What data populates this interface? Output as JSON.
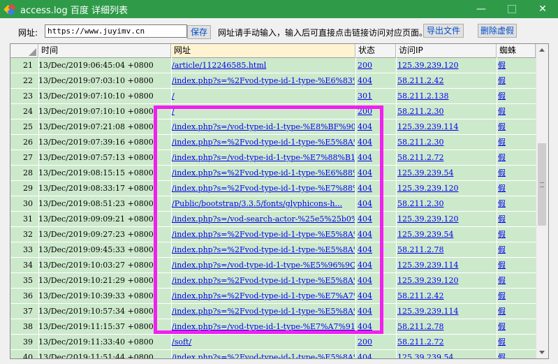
{
  "window": {
    "title": "access.log 百度 详细列表",
    "minimize": "—",
    "close": "✕"
  },
  "toolbar": {
    "url_label": "网址:",
    "url_value": "https://www.juyimv.cn",
    "save_label": "保存",
    "hint": "网址请手动输入，输入后可直接点击链接访问对应页面。",
    "export_label": "导出文件",
    "delete_label": "删除虚假"
  },
  "table": {
    "columns": [
      "时间",
      "网址",
      "状态",
      "访问IP",
      "蜘蛛"
    ],
    "rows": [
      {
        "num": "21",
        "time": "13/Dec/2019:06:45:04 +0800",
        "url": "/article/112246585.html",
        "status": "200",
        "ip": "125.39.239.120",
        "spider": "假"
      },
      {
        "num": "22",
        "time": "13/Dec/2019:07:03:10 +0800",
        "url": "/index.php?s=%2Fvod-type-id-1-type-%E6%83%...",
        "status": "404",
        "ip": "58.211.2.42",
        "spider": "假"
      },
      {
        "num": "23",
        "time": "13/Dec/2019:07:10:10 +0800",
        "url": "/",
        "status": "301",
        "ip": "58.211.2.138",
        "spider": "假"
      },
      {
        "num": "24",
        "time": "13/Dec/2019:07:10:10 +0800",
        "url": "/",
        "status": "200",
        "ip": "58.211.2.30",
        "spider": "假"
      },
      {
        "num": "25",
        "time": "13/Dec/2019:07:21:08 +0800",
        "url": "/index.php?s=/vod-type-id-1-type-%E8%BF%90...",
        "status": "404",
        "ip": "125.39.239.114",
        "spider": "假"
      },
      {
        "num": "26",
        "time": "13/Dec/2019:07:39:16 +0800",
        "url": "/index.php?s=%2Fvod-type-id-1-type-%E5%8A%...",
        "status": "404",
        "ip": "58.211.2.30",
        "spider": "假"
      },
      {
        "num": "27",
        "time": "13/Dec/2019:07:57:13 +0800",
        "url": "/index.php?s=/vod-type-id-1-type-%E7%88%B1...",
        "status": "404",
        "ip": "58.211.2.72",
        "spider": "假"
      },
      {
        "num": "28",
        "time": "13/Dec/2019:08:15:15 +0800",
        "url": "/index.php?s=%2Fvod-type-id-1-type-%E6%88%...",
        "status": "404",
        "ip": "125.39.239.54",
        "spider": "假"
      },
      {
        "num": "29",
        "time": "13/Dec/2019:08:33:17 +0800",
        "url": "/index.php?s=%2Fvod-type-id-1-type-%E7%88%...",
        "status": "404",
        "ip": "125.39.239.120",
        "spider": "假"
      },
      {
        "num": "30",
        "time": "13/Dec/2019:08:51:23 +0800",
        "url": "/Public/bootstrap/3.3.5/fonts/glyphicons-h...",
        "status": "404",
        "ip": "58.211.2.30",
        "spider": "假"
      },
      {
        "num": "31",
        "time": "13/Dec/2019:09:09:21 +0800",
        "url": "/index.php?s=/vod-search-actor-%25e5%25b0%...",
        "status": "404",
        "ip": "125.39.239.120",
        "spider": "假"
      },
      {
        "num": "32",
        "time": "13/Dec/2019:09:27:23 +0800",
        "url": "/index.php?s=%2Fvod-type-id-1-type-%E5%8A%...",
        "status": "404",
        "ip": "125.39.239.54",
        "spider": "假"
      },
      {
        "num": "33",
        "time": "13/Dec/2019:09:45:33 +0800",
        "url": "/index.php?s=%2Fvod-type-id-1-type-%E5%8A%...",
        "status": "404",
        "ip": "58.211.2.78",
        "spider": "假"
      },
      {
        "num": "34",
        "time": "13/Dec/2019:10:03:27 +0800",
        "url": "/index.php?s=/vod-type-id-1-type-%E5%96%9C...",
        "status": "404",
        "ip": "125.39.239.114",
        "spider": "假"
      },
      {
        "num": "35",
        "time": "13/Dec/2019:10:21:29 +0800",
        "url": "/index.php?s=%2Fvod-type-id-1-type-%E5%8A%...",
        "status": "404",
        "ip": "125.39.239.120",
        "spider": "假"
      },
      {
        "num": "36",
        "time": "13/Dec/2019:10:39:33 +0800",
        "url": "/index.php?s=%2Fvod-type-id-1-type-%E7%A7%...",
        "status": "404",
        "ip": "58.211.2.42",
        "spider": "假"
      },
      {
        "num": "37",
        "time": "13/Dec/2019:10:57:34 +0800",
        "url": "/index.php?s=%2Fvod-type-id-1-type-%E5%8A%...",
        "status": "404",
        "ip": "125.39.239.114",
        "spider": "假"
      },
      {
        "num": "38",
        "time": "13/Dec/2019:11:15:37 +0800",
        "url": "/index.php?s=/vod-type-id-1-type-%E7%A7%91...",
        "status": "404",
        "ip": "58.211.2.78",
        "spider": "假"
      },
      {
        "num": "39",
        "time": "13/Dec/2019:11:33:40 +0800",
        "url": "/soft/",
        "status": "200",
        "ip": "58.211.2.72",
        "spider": "假"
      },
      {
        "num": "40",
        "time": "13/Dec/2019:11:51:44 +0800",
        "url": "/index.php?s=%2Fvod-type-id-1-type-%E5%8A%...",
        "status": "404",
        "ip": "125.39.239.54",
        "spider": "假"
      }
    ]
  },
  "colors": {
    "titlebar": "#2f9b49",
    "row_bg": "#cde9cc",
    "link": "#0000ee",
    "highlight": "#f21ff0"
  }
}
